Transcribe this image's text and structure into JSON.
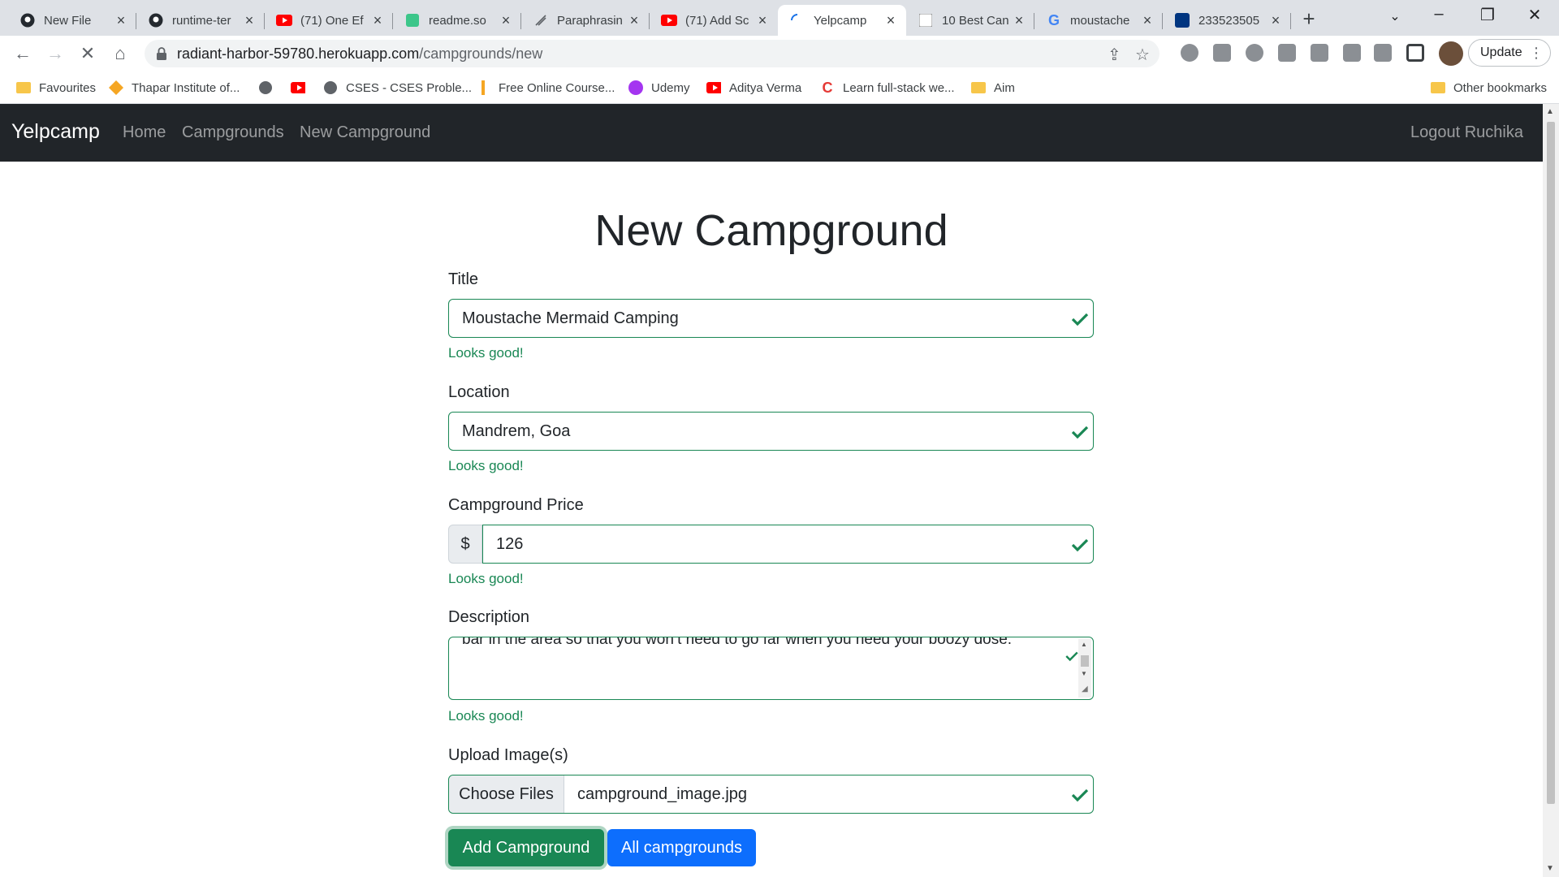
{
  "browser": {
    "tabs": [
      {
        "label": "New File",
        "icon": "github-icon"
      },
      {
        "label": "runtime-ter",
        "icon": "github-icon"
      },
      {
        "label": "(71) One Ef",
        "icon": "youtube-icon"
      },
      {
        "label": "readme.so",
        "icon": "readme-icon"
      },
      {
        "label": "Paraphrasin",
        "icon": "quill-icon"
      },
      {
        "label": "(71) Add Sc",
        "icon": "youtube-icon"
      },
      {
        "label": "Yelpcamp",
        "icon": "loading-icon"
      },
      {
        "label": "10 Best Can",
        "icon": "site-icon"
      },
      {
        "label": "moustache",
        "icon": "google-icon"
      },
      {
        "label": "233523505",
        "icon": "booking-icon"
      }
    ],
    "url_host": "radiant-harbor-59780.herokuapp.com",
    "url_path": "/campgrounds/new",
    "update_label": "Update",
    "bookmarks": [
      {
        "label": "Favourites",
        "icon": "folder-icon"
      },
      {
        "label": "Thapar Institute of...",
        "icon": "thapar-icon"
      },
      {
        "label": "",
        "icon": "globe-icon"
      },
      {
        "label": "",
        "icon": "youtube-icon"
      },
      {
        "label": "CSES - CSES Proble...",
        "icon": "globe-icon"
      },
      {
        "label": "Free Online Course...",
        "icon": "course-icon"
      },
      {
        "label": "Udemy",
        "icon": "udemy-icon"
      },
      {
        "label": "Aditya Verma",
        "icon": "youtube-icon"
      },
      {
        "label": "Learn full-stack we...",
        "icon": "c-icon"
      },
      {
        "label": "Aim",
        "icon": "folder-icon"
      }
    ],
    "other_bookmarks": "Other bookmarks"
  },
  "navbar": {
    "brand": "Yelpcamp",
    "links": [
      "Home",
      "Campgrounds",
      "New Campground"
    ],
    "logout": "Logout Ruchika"
  },
  "form": {
    "heading": "New Campground",
    "title": {
      "label": "Title",
      "value": "Moustache Mermaid Camping",
      "feedback": "Looks good!"
    },
    "location": {
      "label": "Location",
      "value": "Mandrem, Goa",
      "feedback": "Looks good!"
    },
    "price": {
      "label": "Campground Price",
      "prefix": "$",
      "value": "126",
      "feedback": "Looks good!"
    },
    "description": {
      "label": "Description",
      "value": "bar in the area so that you won’t need to go far when you need your boozy dose.",
      "feedback": "Looks good!"
    },
    "images": {
      "label": "Upload Image(s)",
      "button": "Choose Files",
      "filename": "campground_image.jpg"
    },
    "buttons": {
      "add": "Add Campground",
      "all": "All campgrounds"
    }
  },
  "colors": {
    "success": "#198754",
    "primary": "#0d6efd",
    "navbar": "#212529"
  }
}
